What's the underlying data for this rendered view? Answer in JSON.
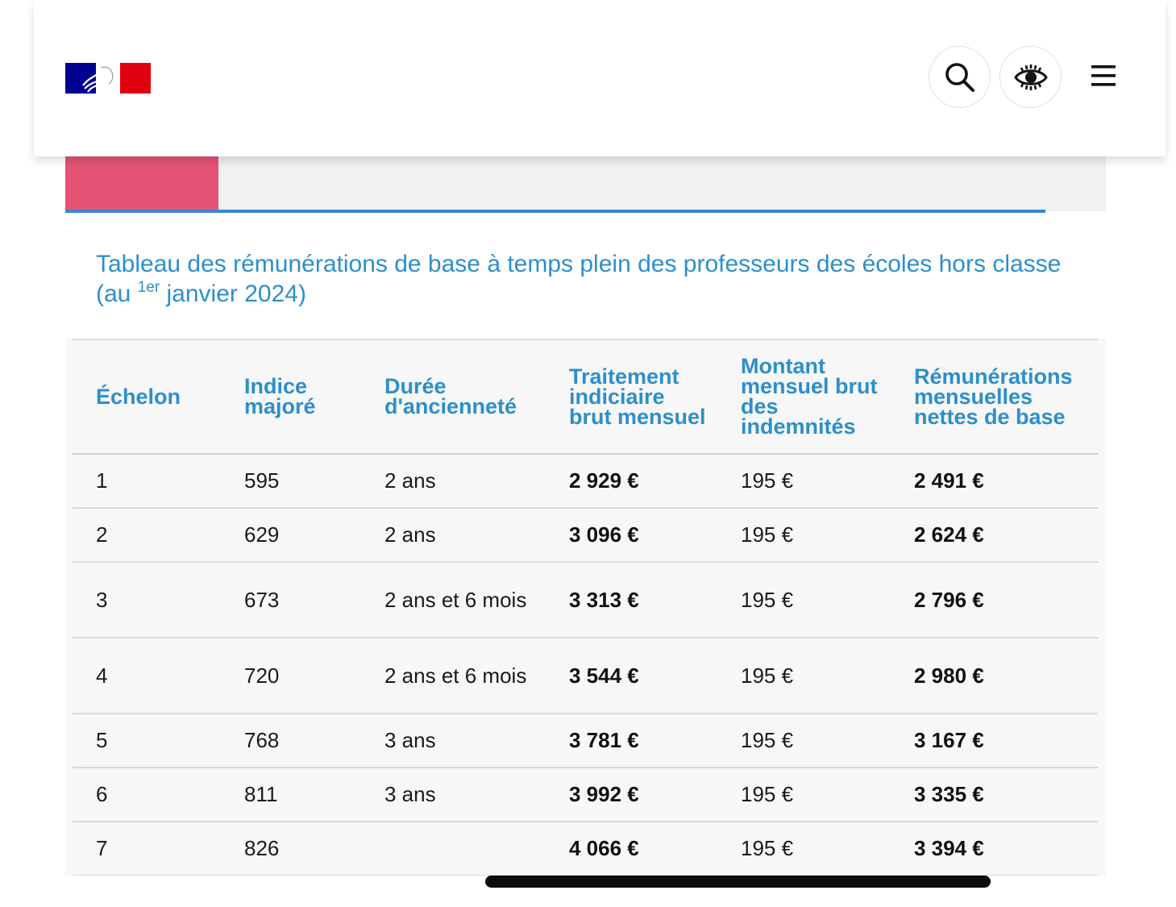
{
  "header": {
    "logo": "republique-francaise-logo",
    "search_icon": "search-icon",
    "accessibility_icon": "eye-accessibility-icon",
    "menu_icon": "hamburger-menu-icon",
    "brand_blue": "#000091",
    "brand_red": "#e1000f"
  },
  "tabs": {
    "active_color": "#e55375",
    "underline_color": "#3888d0"
  },
  "table": {
    "caption_main": "Tableau des rémunérations de base à temps plein des professeurs des écoles hors classe (au ",
    "caption_sup": "1er",
    "caption_end": " janvier 2024)",
    "header_color": "#2d8fca",
    "columns": [
      "Échelon",
      "Indice majoré",
      "Durée d'ancienneté",
      "Traitement indiciaire brut mensuel",
      "Montant mensuel brut des indemnités",
      "Rémunérations mensuelles nettes de base"
    ],
    "rows": [
      {
        "echelon": "1",
        "indice": "595",
        "duree": "2 ans",
        "traitement": "2 929 €",
        "indemnites": "195 €",
        "net": "2 491 €"
      },
      {
        "echelon": "2",
        "indice": "629",
        "duree": "2 ans",
        "traitement": "3 096 €",
        "indemnites": "195 €",
        "net": "2 624 €"
      },
      {
        "echelon": "3",
        "indice": "673",
        "duree": "2 ans et 6 mois",
        "traitement": "3 313 €",
        "indemnites": "195 €",
        "net": "2 796 €"
      },
      {
        "echelon": "4",
        "indice": "720",
        "duree": "2 ans et 6 mois",
        "traitement": "3 544 €",
        "indemnites": "195 €",
        "net": "2 980 €"
      },
      {
        "echelon": "5",
        "indice": "768",
        "duree": "3 ans",
        "traitement": "3 781 €",
        "indemnites": "195 €",
        "net": "3 167 €"
      },
      {
        "echelon": "6",
        "indice": "811",
        "duree": "3 ans",
        "traitement": "3 992 €",
        "indemnites": "195 €",
        "net": "3 335 €"
      },
      {
        "echelon": "7",
        "indice": "826",
        "duree": "",
        "traitement": "4 066 €",
        "indemnites": "195 €",
        "net": "3 394 €"
      }
    ]
  }
}
